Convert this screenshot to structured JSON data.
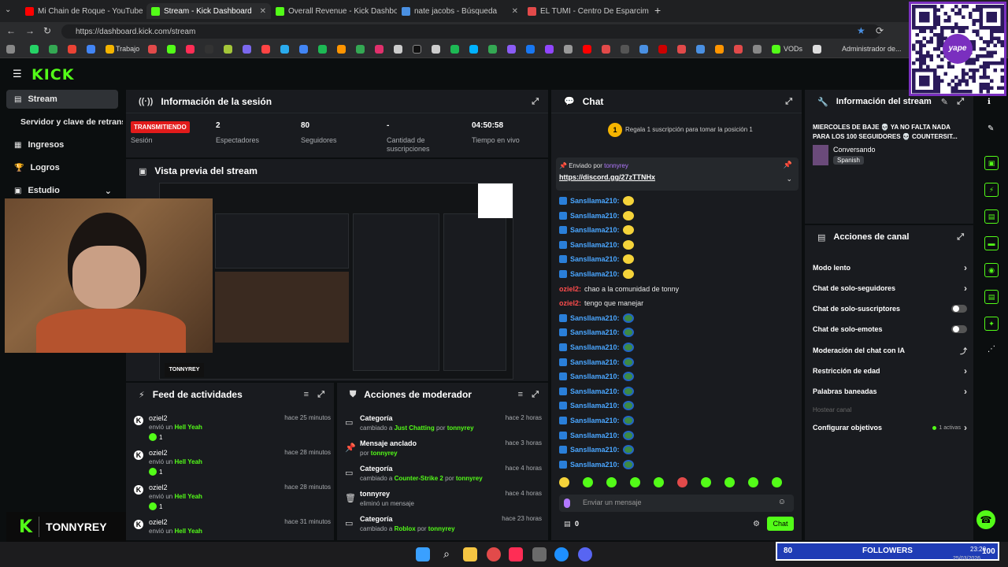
{
  "browser": {
    "tabs": [
      {
        "title": "Mi Chain de Roque - YouTube",
        "color": "#ff0000"
      },
      {
        "title": "Stream - Kick Dashboard",
        "color": "#53fc18"
      },
      {
        "title": "Overall Revenue - Kick Dashboard",
        "color": "#53fc18"
      },
      {
        "title": "nate jacobs - Búsqueda",
        "color": "#4a90e2"
      },
      {
        "title": "EL TUMI - Centro De Esparcimient",
        "color": "#e24a4a"
      }
    ],
    "new_tab": "+",
    "url": "https://dashboard.kick.com/stream",
    "bookmarks": {
      "trabajo": "Trabajo",
      "vods": "VODs",
      "admin": "Administrador de..."
    }
  },
  "kick": {
    "logo": "KICK",
    "sidebar": [
      {
        "label": "Stream"
      },
      {
        "label": "Servidor y clave de retransm"
      },
      {
        "label": "Ingresos"
      },
      {
        "label": "Logros"
      },
      {
        "label": "Estudio"
      }
    ]
  },
  "session": {
    "title": "Información de la sesión",
    "live_badge": "TRANSMITIENDO",
    "live_label": "Sesión",
    "stats": [
      {
        "value": "2",
        "label": "Espectadores"
      },
      {
        "value": "80",
        "label": "Seguidores"
      },
      {
        "value": "-",
        "label": "Cantidad de suscripciones"
      },
      {
        "value": "04:50:58",
        "label": "Tiempo en vivo"
      }
    ]
  },
  "preview": {
    "title": "Vista previa del stream",
    "streamer": "TONNYREY"
  },
  "activity": {
    "title": "Feed de actividades",
    "items": [
      {
        "user": "oziel2",
        "action": "envió un",
        "item": "Hell Yeah",
        "time": "hace 25 minutos",
        "count": "1"
      },
      {
        "user": "oziel2",
        "action": "envió un",
        "item": "Hell Yeah",
        "time": "hace 28 minutos",
        "count": "1"
      },
      {
        "user": "oziel2",
        "action": "envió un",
        "item": "Hell Yeah",
        "time": "hace 28 minutos",
        "count": "1"
      },
      {
        "user": "oziel2",
        "action": "envió un",
        "item": "Hell Yeah",
        "time": "hace 31 minutos",
        "count": ""
      }
    ]
  },
  "moderator": {
    "title": "Acciones de moderador",
    "items": [
      {
        "action": "Categoría",
        "pre": "cambiado a",
        "target": "Just Chatting",
        "by": "por",
        "user": "tonnyrey",
        "time": "hace 2 horas"
      },
      {
        "action": "Mensaje anclado",
        "pre": "por",
        "target": "",
        "by": "",
        "user": "tonnyrey",
        "time": "hace 3 horas"
      },
      {
        "action": "Categoría",
        "pre": "cambiado a",
        "target": "Counter-Strike 2",
        "by": "por",
        "user": "tonnyrey",
        "time": "hace 4 horas"
      },
      {
        "action": "tonnyrey",
        "pre": "eliminó un mensaje",
        "target": "",
        "by": "",
        "user": "",
        "time": "hace 4 horas"
      },
      {
        "action": "Categoría",
        "pre": "cambiado a",
        "target": "Roblox",
        "by": "por",
        "user": "tonnyrey",
        "time": "hace 23 horas"
      }
    ]
  },
  "chat": {
    "title": "Chat",
    "sub_goal": "Regala 1 suscripción para tomar la posición 1",
    "sub_goal_rank": "1",
    "pinned_by": "Enviado por",
    "pinned_user": "tonnyrey",
    "pinned_link": "https://discord.gg/27zTTNHx",
    "messages": [
      {
        "user": "Sansllama210:",
        "text": "",
        "emote": "yellow"
      },
      {
        "user": "Sansllama210:",
        "text": "",
        "emote": "yellow"
      },
      {
        "user": "Sansllama210:",
        "text": "",
        "emote": "yellow"
      },
      {
        "user": "Sansllama210:",
        "text": "",
        "emote": "yellow"
      },
      {
        "user": "Sansllama210:",
        "text": "",
        "emote": "yellow"
      },
      {
        "user": "Sansllama210:",
        "text": "",
        "emote": "yellow"
      },
      {
        "user": "oziel2:",
        "text": "chao a la comunidad de tonny",
        "emote": ""
      },
      {
        "user": "oziel2:",
        "text": "tengo que manejar",
        "emote": ""
      },
      {
        "user": "Sansllama210:",
        "text": "",
        "emote": "pepe"
      },
      {
        "user": "Sansllama210:",
        "text": "",
        "emote": "pepe"
      },
      {
        "user": "Sansllama210:",
        "text": "",
        "emote": "pepe"
      },
      {
        "user": "Sansllama210:",
        "text": "",
        "emote": "pepe"
      },
      {
        "user": "Sansllama210:",
        "text": "",
        "emote": "pepe"
      },
      {
        "user": "Sansllama210:",
        "text": "",
        "emote": "pepe"
      },
      {
        "user": "Sansllama210:",
        "text": "",
        "emote": "pepe"
      },
      {
        "user": "Sansllama210:",
        "text": "",
        "emote": "pepe"
      },
      {
        "user": "Sansllama210:",
        "text": "",
        "emote": "pepe"
      },
      {
        "user": "Sansllama210:",
        "text": "",
        "emote": "pepe"
      },
      {
        "user": "Sansllama210:",
        "text": "",
        "emote": "pepe"
      }
    ],
    "input_placeholder": "Enviar un mensaje",
    "points": "0",
    "send_label": "Chat"
  },
  "stream_info": {
    "title": "Información del stream",
    "stream_title": "MIERCOLES DE BAJE 💀 YA NO FALTA NADA PARA LOS 100 SEGUIDORES 💀 COUNTERSIT...",
    "category": "Conversando",
    "language": "Spanish"
  },
  "channel_actions": {
    "title": "Acciones de canal",
    "items": [
      {
        "label": "Modo lento",
        "control": "arrow"
      },
      {
        "label": "Chat de solo-seguidores",
        "control": "arrow"
      },
      {
        "label": "Chat de solo-suscriptores",
        "control": "toggle"
      },
      {
        "label": "Chat de solo-emotes",
        "control": "toggle"
      },
      {
        "label": "Moderación del chat con IA",
        "control": "ext"
      },
      {
        "label": "Restricción de edad",
        "control": "arrow"
      },
      {
        "label": "Palabras baneadas",
        "control": "arrow"
      },
      {
        "label": "Hostear canal",
        "control": "disabled"
      },
      {
        "label": "Configurar objetivos",
        "control": "arrow"
      }
    ],
    "goals_active": "1 activas"
  },
  "overlay": {
    "followers_count": "80",
    "followers_label": "FOLLOWERS",
    "qr_brand": "yape"
  },
  "taskbar": {
    "time": "23:20",
    "date": "25/03/2026",
    "volume": "100"
  },
  "colors": {
    "kick_green": "#53fc18",
    "panel": "#191b1f",
    "bg": "#0b0e0f",
    "live_red": "#e21b1b",
    "follow_blue": "#1f3cb5"
  }
}
